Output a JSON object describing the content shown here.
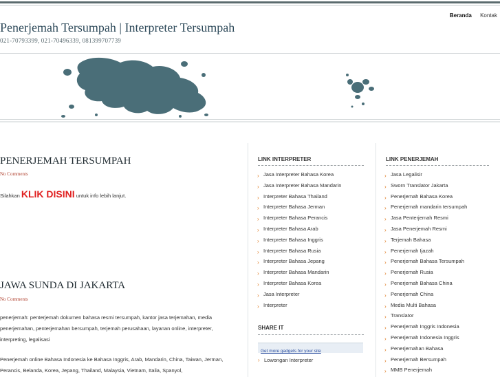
{
  "nav": {
    "items": [
      "Beranda",
      "Kontak"
    ]
  },
  "header": {
    "title": "Penerjemah Tersumpah | Interpreter Tersumpah",
    "subtitle": "021-70793399, 021-70496339, 081399707739"
  },
  "colors": {
    "accent_red": "#e02020",
    "bullet_orange": "#e07d25",
    "link_blue": "#2a4ea0",
    "title_blue": "#2e4a5a"
  },
  "posts": [
    {
      "title": "PENERJEMAH TERSUMPAH",
      "comments": "No Comments",
      "text_before": "Silahkan ",
      "link_label": "KLIK DISINI",
      "text_after": " untuk info lebih lanjut."
    },
    {
      "title": "JAWA SUNDA DI JAKARTA",
      "comments": "No Comments",
      "para1": "penerjemah: penterjemah dokumen bahasa resmi tersumpah, kantor jasa terjemahan, media penerjemahan, penterjemahan bersumpah, terjemah perusahaan, layanan online, interpreter, interpreting, legalisasi",
      "para2": "Penerjemah online Bahasa Indonesia ke Bahasa Inggris, Arab, Mandarin, China, Taiwan, Jerman, Perancis, Belanda, Korea, Jepang, Thailand, Malaysia, Vietnam, Italia, Spanyol,"
    }
  ],
  "sidebar_interpreter": {
    "heading": "LINK INTERPRETER",
    "items": [
      "Jasa Interpreter Bahasa Korea",
      "Jasa Interpreter Bahasa Mandarin",
      "Interpreter Bahasa Thailand",
      "Interpreter Bahasa Jerman",
      "Interpreter Bahasa Perancis",
      "Interpreter Bahasa Arab",
      "Interpreter Bahasa Inggris",
      "Interpreter Bahasa Rusia",
      "Interpreter Bahasa Jepang",
      "Interpreter Bahasa Mandarin",
      "Interpreter Bahasa Korea",
      "Jasa Interpreter",
      "Interpreter"
    ]
  },
  "share": {
    "heading": "SHARE IT",
    "gadget_link": "Get more gadgets for your site",
    "item": "Lowongan Interpreter"
  },
  "sidebar_penerjemah": {
    "heading": "LINK PENERJEMAH",
    "items": [
      "Jasa Legalisir",
      "Sworn Translator Jakarta",
      "Penerjemah Bahasa Korea",
      "Penerjemah mandarin tersumpah",
      "Jasa Penterjemah Resmi",
      "Jasa Penerjemah Resmi",
      "Terjemah Bahasa",
      "Penerjemah Ijazah",
      "Penerjemah Bahasa Tersumpah",
      "Penerjemah Rusia",
      "Penerjemah Bahasa China",
      "Penerjemah China",
      "Media Multi Bahasa",
      "Translator",
      "Penerjemah Inggris Indonesia",
      "Penerjemah Indonesia Inggris",
      "Penerjemahan Bahasa",
      "Penerjemah Bersumpah",
      "MMB Penerjemah"
    ]
  }
}
